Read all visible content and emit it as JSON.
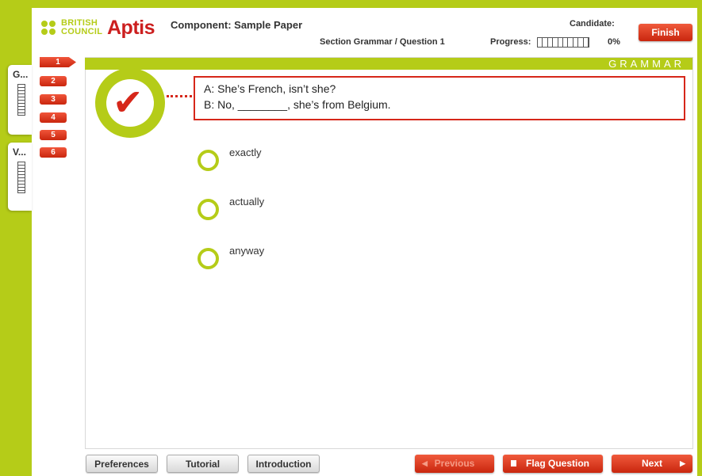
{
  "header": {
    "brand": "BRITISH COUNCIL",
    "brand_line1": "BRITISH",
    "brand_line2": "COUNCIL",
    "product": "Aptis",
    "component": "Component: Sample Paper",
    "section_question": "Section Grammar / Question 1",
    "progress_label": "Progress:",
    "progress_value": 0,
    "progress_text": "0%",
    "candidate_label": "Candidate:",
    "finish_label": "Finish"
  },
  "sections": [
    {
      "label": "G..."
    },
    {
      "label": "V..."
    }
  ],
  "question_numbers": [
    "1",
    "2",
    "3",
    "4",
    "5",
    "6"
  ],
  "active_question": "1",
  "section_banner": "GRAMMAR",
  "question": {
    "line1": "A: She’s French, isn’t she?",
    "line2": "B: No, ________, she’s from Belgium."
  },
  "options": [
    {
      "label": "exactly"
    },
    {
      "label": "actually"
    },
    {
      "label": "anyway"
    }
  ],
  "footer": {
    "preferences": "Preferences",
    "tutorial": "Tutorial",
    "introduction": "Introduction",
    "previous": "Previous",
    "flag": "Flag Question",
    "next": "Next"
  },
  "colors": {
    "accent_green": "#b5cc18",
    "accent_red": "#d6271a"
  }
}
